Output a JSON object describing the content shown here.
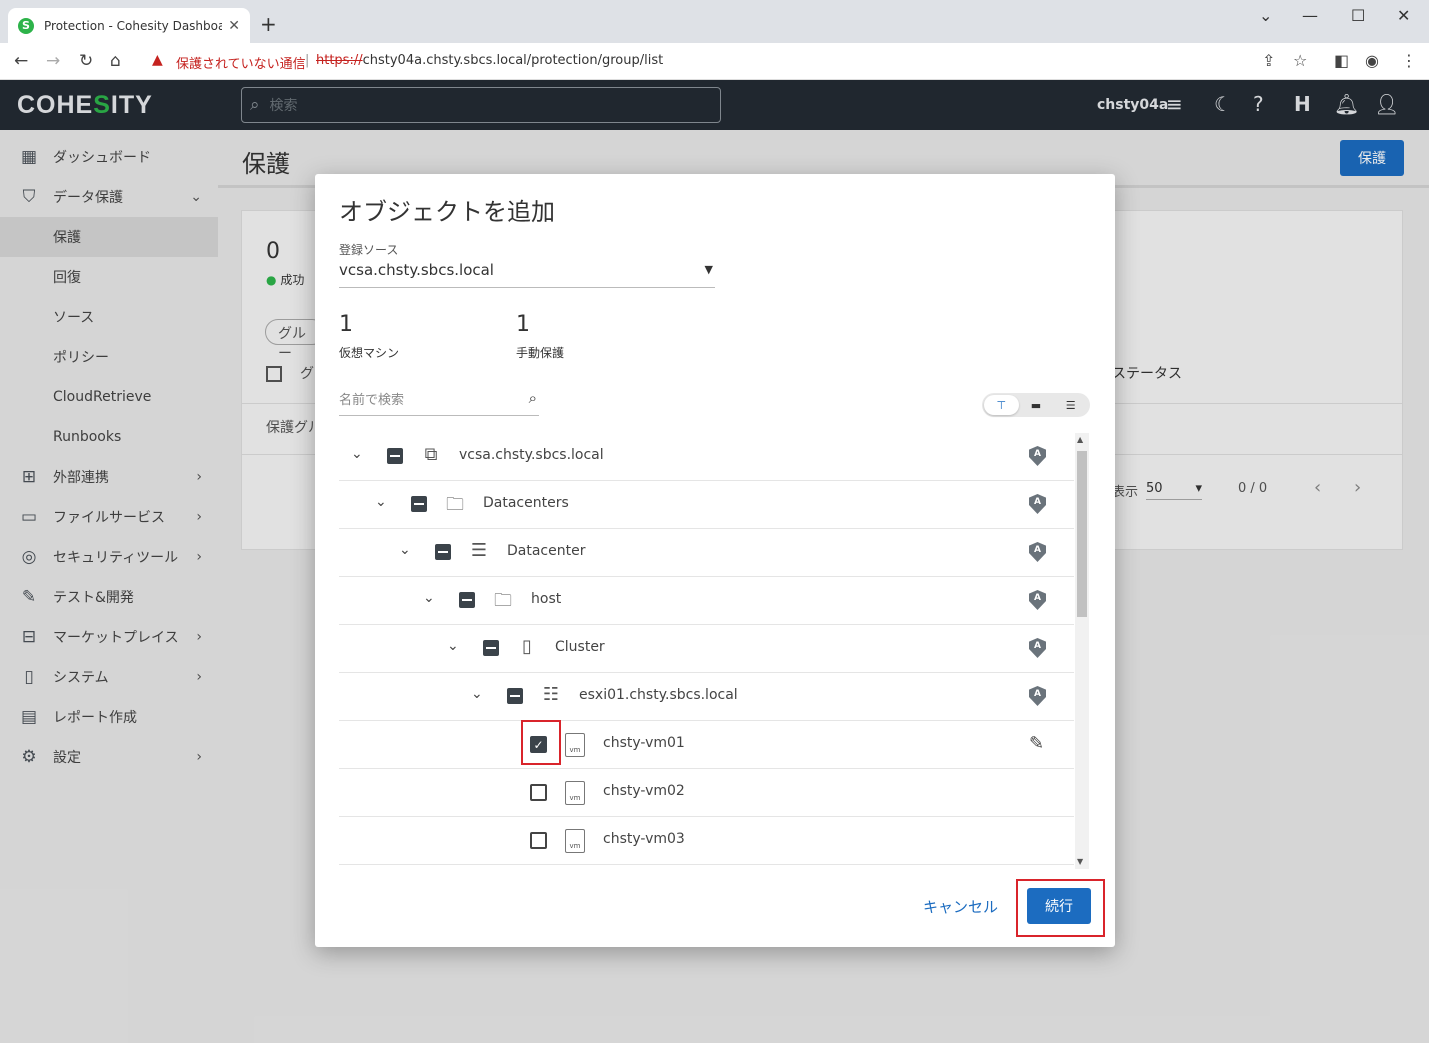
{
  "browser": {
    "tab_title": "Protection - Cohesity Dashboard",
    "favicon": "S",
    "insecure_label": "保護されていない通信",
    "url_proto": "https://",
    "url_rest": "chsty04a.chsty.sbcs.local/protection/group/list"
  },
  "header": {
    "logo_pre": "COHE",
    "logo_s": "S",
    "logo_post": "ITY",
    "search_placeholder": "検索",
    "user": "chsty04a",
    "h_badge": "H"
  },
  "sidebar": {
    "items": [
      {
        "label": "ダッシュボード",
        "icon": "dashboard-icon"
      },
      {
        "label": "データ保護",
        "icon": "shield-icon"
      },
      {
        "label": "保護"
      },
      {
        "label": "回復"
      },
      {
        "label": "ソース"
      },
      {
        "label": "ポリシー"
      },
      {
        "label": "CloudRetrieve"
      },
      {
        "label": "Runbooks"
      },
      {
        "label": "外部連携",
        "icon": "hierarchy-icon"
      },
      {
        "label": "ファイルサービス",
        "icon": "folder-icon"
      },
      {
        "label": "セキュリティツール",
        "icon": "fingerprint-icon"
      },
      {
        "label": "テスト&開発",
        "icon": "wrench-icon"
      },
      {
        "label": "マーケットプレイス",
        "icon": "store-icon"
      },
      {
        "label": "システム",
        "icon": "system-icon"
      },
      {
        "label": "レポート作成",
        "icon": "report-icon"
      },
      {
        "label": "設定",
        "icon": "gear-icon"
      }
    ]
  },
  "main": {
    "title": "保護",
    "protect_button": "保護",
    "count": "0",
    "success_label": "成功",
    "chip": "グルー",
    "col_g": "グ",
    "col_status": "ステータス",
    "row_group": "保護グル",
    "per_page_label": "表示",
    "per_page": "50",
    "range": "0 / 0"
  },
  "dialog": {
    "title": "オブジェクトを追加",
    "source_label": "登録ソース",
    "source_value": "vcsa.chsty.sbcs.local",
    "vm_count": "1",
    "vm_label": "仮想マシン",
    "manual_count": "1",
    "manual_label": "手動保護",
    "search_placeholder": "名前で検索",
    "tree": [
      {
        "name": "vcsa.chsty.sbcs.local",
        "icon": "vcenter-icon"
      },
      {
        "name": "Datacenters",
        "icon": "folder-icon"
      },
      {
        "name": "Datacenter",
        "icon": "datacenter-icon"
      },
      {
        "name": "host",
        "icon": "folder-icon"
      },
      {
        "name": "Cluster",
        "icon": "cluster-icon"
      },
      {
        "name": "esxi01.chsty.sbcs.local",
        "icon": "host-icon"
      },
      {
        "name": "chsty-vm01",
        "icon": "windows-vm-icon",
        "checked": true
      },
      {
        "name": "chsty-vm02",
        "icon": "linux-vm-icon",
        "checked": false
      },
      {
        "name": "chsty-vm03",
        "icon": "linux-vm-icon",
        "checked": false
      }
    ],
    "shield_letter": "A",
    "vm_tag": "vm",
    "cancel": "キャンセル",
    "continue": "続行"
  },
  "colors": {
    "accent": "#1c6cc0",
    "header_bg": "#232b33",
    "highlight": "#d9242b",
    "success": "#2db34a"
  }
}
